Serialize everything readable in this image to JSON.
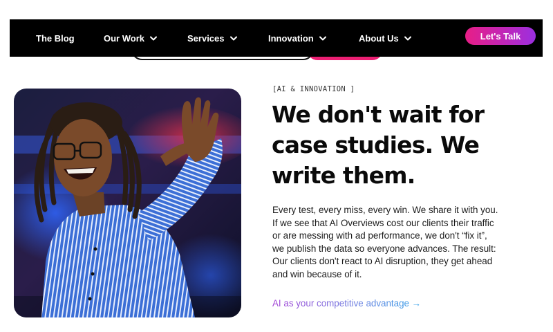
{
  "nav": {
    "items": [
      {
        "label": "The Blog",
        "dropdown": false
      },
      {
        "label": "Our Work",
        "dropdown": true
      },
      {
        "label": "Services",
        "dropdown": true
      },
      {
        "label": "Innovation",
        "dropdown": true
      },
      {
        "label": "About Us",
        "dropdown": true
      }
    ],
    "cta_label": "Let's Talk"
  },
  "hero": {
    "eyebrow": "[AI & INNOVATION ]",
    "headline": "We don't wait for case studies. We write them.",
    "body": "Every test, every miss, every win. We share it with you. If we see that AI Overviews cost our clients their traffic or are messing with ad performance, we don't “fix it”, we publish the data so everyone advances. The result: Our clients don't react to AI disruption, they get ahead and win because of it.",
    "link_label": "AI as your competitive advantage →"
  },
  "colors": {
    "nav_bg": "#000000",
    "cta_gradient_start": "#e81e86",
    "cta_gradient_end": "#9b2fe0",
    "link_gradient_start": "#a23fd6",
    "link_gradient_end": "#2f9fe8"
  },
  "icons": {
    "dropdown": "chevron-down-icon"
  }
}
